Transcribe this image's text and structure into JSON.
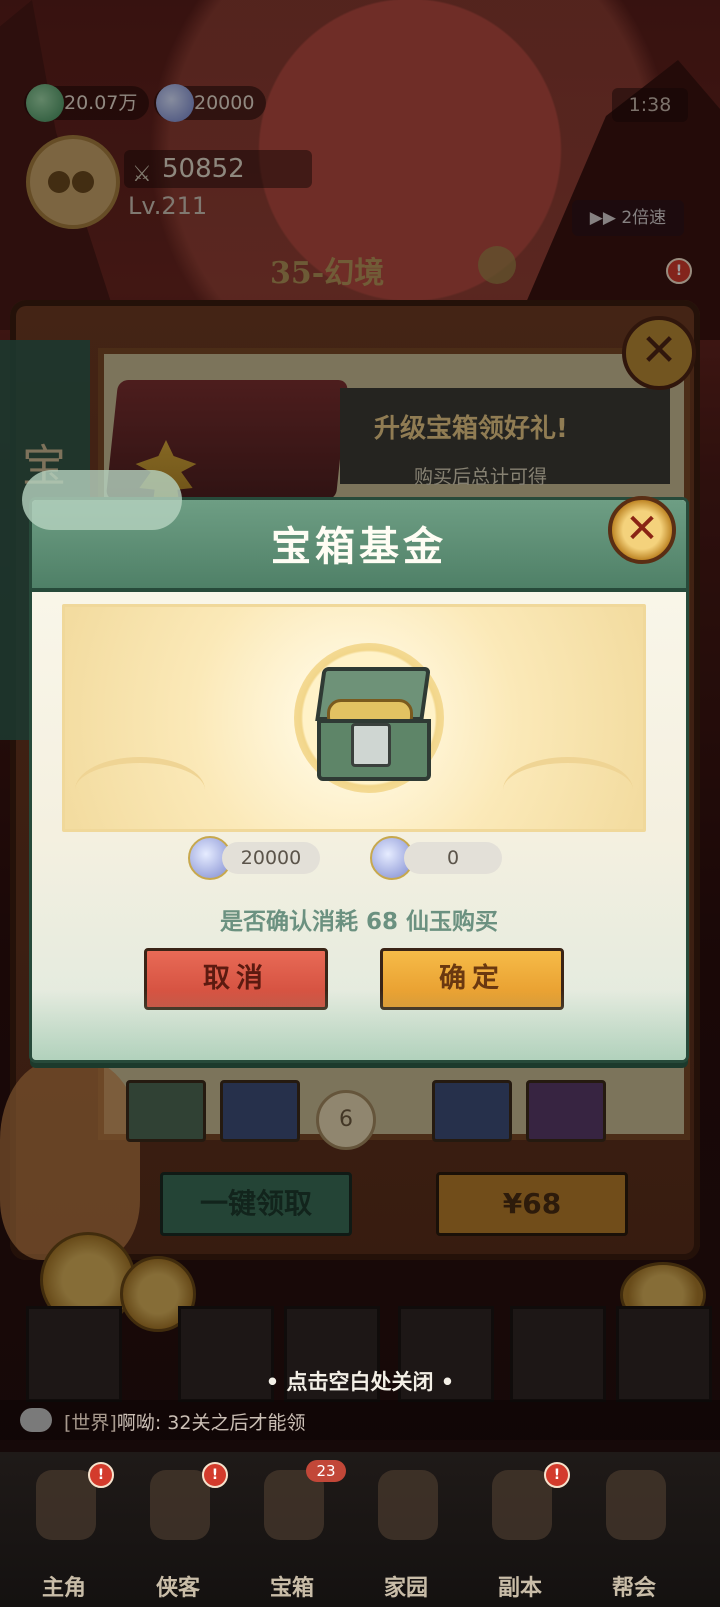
{
  "hud": {
    "currency_green": "20.07万",
    "currency_blue": "20000",
    "clock": "1:38",
    "power": "50852",
    "level": "Lv.211",
    "speed": "2倍速",
    "stage": "35-幻境"
  },
  "background_panel": {
    "side_banner": "宝",
    "promo_title": "升级宝箱领好礼!",
    "promo_subtitle": "购买后总计可得",
    "progress_node": "6",
    "claim_all_button": "一键领取",
    "price_button": "¥68"
  },
  "dialog": {
    "title": "宝箱基金",
    "jade_balance": "20000",
    "ticket_balance": "0",
    "confirm_text": "是否确认消耗 68 仙玉购买",
    "cancel_label": "取消",
    "ok_label": "确定"
  },
  "tap_hint": "• 点击空白处关闭 •",
  "chat": {
    "channel": "[世界]",
    "sender": "啊呦:",
    "message": "32关之后才能领"
  },
  "nav": {
    "items": [
      {
        "label": "主角",
        "badge": "!"
      },
      {
        "label": "侠客",
        "badge": "!"
      },
      {
        "label": "宝箱",
        "badge": "23"
      },
      {
        "label": "家园",
        "badge": ""
      },
      {
        "label": "副本",
        "badge": "!"
      },
      {
        "label": "帮会",
        "badge": ""
      }
    ]
  },
  "colors": {
    "dialog_header": "#5a8a70",
    "cancel_button": "#d9503f",
    "ok_button": "#eda339",
    "confirm_text": "#6b9180"
  }
}
